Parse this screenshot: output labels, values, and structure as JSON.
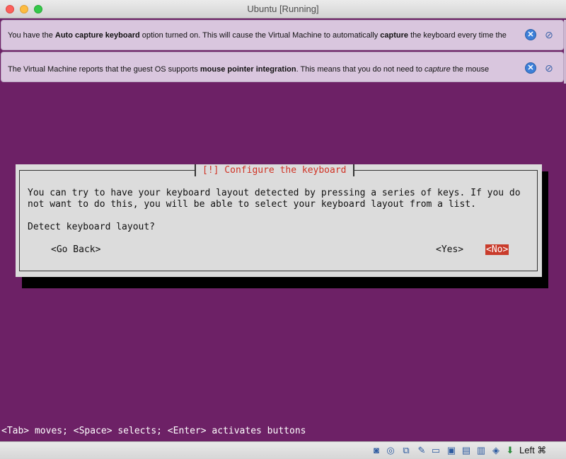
{
  "window": {
    "title": "Ubuntu [Running]"
  },
  "notices": [
    {
      "segments": [
        {
          "t": "You have the ",
          "s": ""
        },
        {
          "t": "Auto capture keyboard",
          "s": "b"
        },
        {
          "t": " option turned on. This will cause the Virtual Machine to automatically ",
          "s": ""
        },
        {
          "t": "capture",
          "s": "b"
        },
        {
          "t": " the keyboard every time the",
          "s": ""
        }
      ]
    },
    {
      "segments": [
        {
          "t": "The Virtual Machine reports that the guest OS supports ",
          "s": ""
        },
        {
          "t": "mouse pointer integration",
          "s": "b"
        },
        {
          "t": ". This means that you do not need to ",
          "s": ""
        },
        {
          "t": "capture",
          "s": "i"
        },
        {
          "t": " the mouse",
          "s": ""
        }
      ]
    }
  ],
  "dialog": {
    "title": "[!] Configure the keyboard",
    "body_line1": "You can try to have your keyboard layout detected by pressing a series of keys. If you do",
    "body_line2": "not want to do this, you will be able to select your keyboard layout from a list.",
    "question": "Detect keyboard layout?",
    "go_back": "<Go Back>",
    "yes": "<Yes>",
    "no": "<No>"
  },
  "status_line": "<Tab> moves; <Space> selects; <Enter> activates buttons",
  "vbox_status": {
    "host_key": "Left ⌘",
    "icons": [
      "hard-disk-icon",
      "optical-drive-icon",
      "usb-icon",
      "shared-folders-icon",
      "display-icon",
      "network-icon",
      "recording-icon",
      "cpu-icon",
      "mouse-integration-icon",
      "host-key-arrow-icon"
    ]
  },
  "colors": {
    "console_bg": "#6d2166",
    "dialog_bg": "#dcdcdc",
    "dialog_title": "#d03325",
    "focused_button": "#c93c2c",
    "notice_bg": "#d9c6de"
  }
}
